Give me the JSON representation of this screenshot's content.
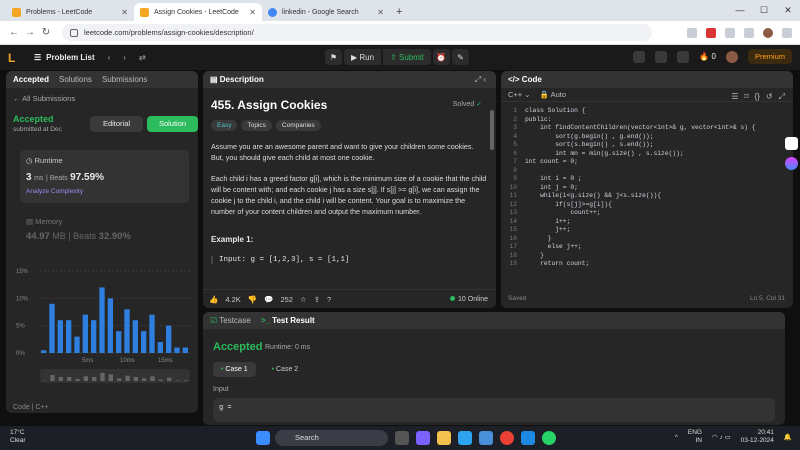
{
  "browser": {
    "tabs": [
      {
        "label": "Problems - LeetCode",
        "color": "#f5a623"
      },
      {
        "label": "Assign Cookies - LeetCode",
        "color": "#f5a623"
      },
      {
        "label": "linkedin - Google Search",
        "color": "#4285f4"
      }
    ],
    "url": "leetcode.com/problems/assign-cookies/description/"
  },
  "header": {
    "problem_list": "Problem List",
    "run": "Run",
    "submit": "Submit",
    "streak": "0",
    "premium": "Premium"
  },
  "left_panel": {
    "tabs": [
      "Accepted",
      "Solutions",
      "Submissions"
    ],
    "all_submissions": "← All Submissions",
    "status": "Accepted",
    "submitted": "submitted at Dec",
    "editorial": "Editorial",
    "solution": "Solution",
    "runtime_label": "Runtime",
    "runtime_value": "3",
    "runtime_unit": "ms",
    "beats": "Beats",
    "runtime_pct": "97.59%",
    "analyze": "Analyze Complexity",
    "memory_label": "Memory",
    "memory_value": "44.97",
    "memory_unit": "MB",
    "memory_pct": "32.90%",
    "code_footer": "Code | C++",
    "chart_data": {
      "type": "bar",
      "ylabels": [
        "15%",
        "10%",
        "5%",
        "0%"
      ],
      "xlabels": [
        "5ms",
        "10ms",
        "15ms"
      ],
      "values": [
        0.5,
        9,
        6,
        6,
        3,
        7,
        6,
        12,
        10,
        4,
        8,
        6,
        4,
        7,
        2,
        5,
        1,
        1
      ],
      "ylim": [
        0,
        15
      ]
    }
  },
  "description": {
    "title": "455. Assign Cookies",
    "solved": "Solved",
    "tags": [
      "Easy",
      "Topics",
      "Companies"
    ],
    "p1": "Assume you are an awesome parent and want to give your children some cookies. But, you should give each child at most one cookie.",
    "p2": "Each child i has a greed factor g[i], which is the minimum size of a cookie that the child will be content with; and each cookie j has a size s[j]. If s[j] >= g[i], we can assign the cookie j to the child i, and the child i will be content. Your goal is to maximize the number of your content children and output the maximum number.",
    "example_title": "Example 1:",
    "example_input": "Input: g = [1,2,3], s = [1,1]",
    "likes": "4.2K",
    "comments": "252",
    "online": "10 Online"
  },
  "code": {
    "title": "Code",
    "lang": "C++",
    "auto": "Auto",
    "saved": "Saved",
    "cursor": "Ln 5, Col 31",
    "lines": [
      "class Solution {",
      "public:",
      "    int findContentChildren(vector<int>& g, vector<int>& s) {",
      "        sort(g.begin() , g.end());",
      "        sort(s.begin() , s.end());",
      "        int mn = min(g.size() , s.size());",
      "int count = 0;",
      "",
      "    int i = 0 ;",
      "    int j = 0;",
      "    while(i<g.size() && j<s.size()){",
      "        if(s[j]>=g[i]){",
      "            count++;",
      "        i++;",
      "        j++;",
      "      }",
      "      else j++;",
      "    }",
      "    return count;"
    ]
  },
  "result": {
    "testcase_tab": "Testcase",
    "result_tab": "Test Result",
    "status": "Accepted",
    "runtime": "Runtime: 0 ms",
    "cases": [
      "Case 1",
      "Case 2"
    ],
    "input_label": "Input",
    "input_value": "g ="
  },
  "taskbar": {
    "temp": "17°C",
    "weather": "Clear",
    "search": "Search",
    "lang1": "ENG",
    "lang2": "IN",
    "time": "20:41",
    "date": "03-12-2024"
  }
}
